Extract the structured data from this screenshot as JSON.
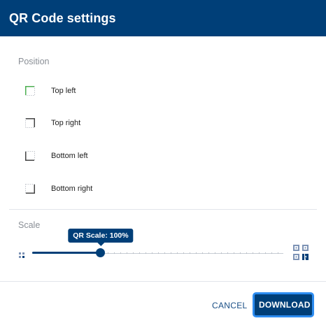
{
  "dialog": {
    "title": "QR Code settings"
  },
  "position": {
    "label": "Position",
    "selected": "Top left",
    "options": [
      {
        "label": "Top left",
        "corner": "top-left",
        "selected": true
      },
      {
        "label": "Top right",
        "corner": "top-right",
        "selected": false
      },
      {
        "label": "Bottom left",
        "corner": "bottom-left",
        "selected": false
      },
      {
        "label": "Bottom right",
        "corner": "bottom-right",
        "selected": false
      }
    ]
  },
  "scale": {
    "label": "Scale",
    "value_percent": 100,
    "min_percent": 25,
    "max_percent": 300,
    "tick_count": 40,
    "tooltip": "QR Scale: 100%",
    "small_icon": "qr-small-icon",
    "large_icon": "qr-large-icon"
  },
  "footer": {
    "cancel_label": "CANCEL",
    "download_label": "DOWNLOAD"
  },
  "colors": {
    "header_bg": "#003f78",
    "accent": "#003f78",
    "selected_corner": "#4caf50",
    "focus_ring": "#2d8cf0",
    "link": "#1a4f86"
  }
}
